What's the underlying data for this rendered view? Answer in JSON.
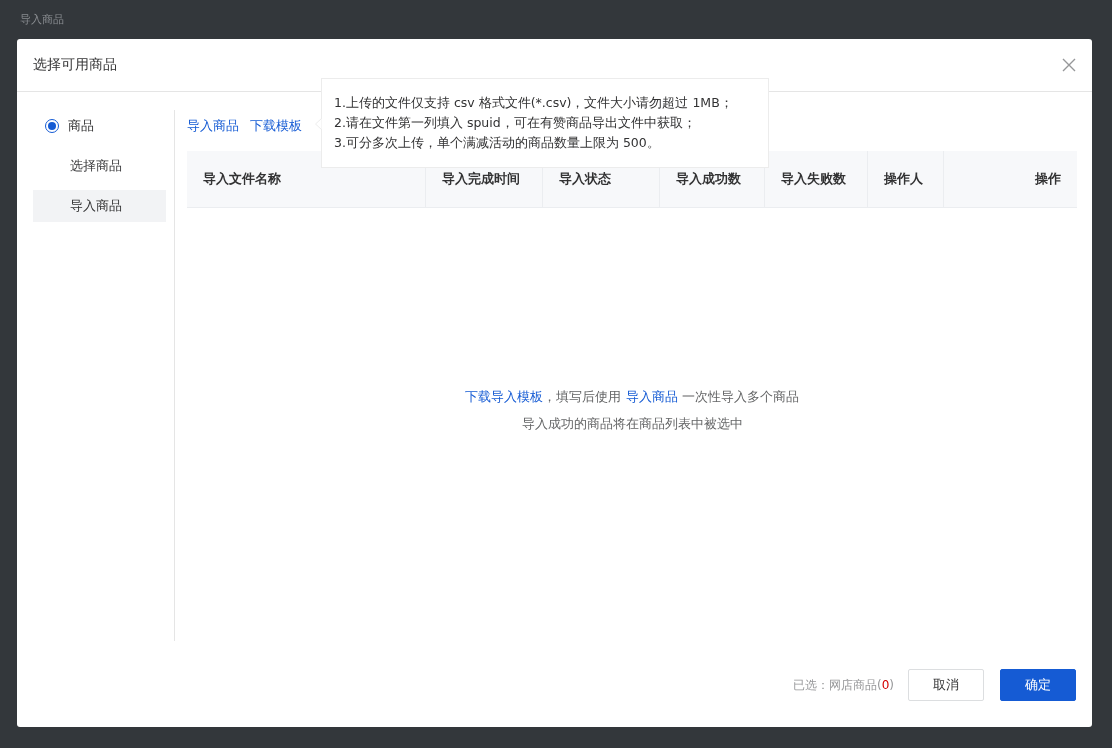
{
  "page_title": "导入商品",
  "dialog": {
    "title": "选择可用商品",
    "sidebar": {
      "group": {
        "label": "商品",
        "selected": true
      },
      "items": [
        {
          "label": "选择商品",
          "selected": false
        },
        {
          "label": "导入商品",
          "selected": true
        }
      ]
    },
    "actions": [
      {
        "label": "导入商品"
      },
      {
        "label": "下载模板"
      }
    ],
    "tooltip": {
      "lines": [
        "1.上传的文件仅支持 csv 格式文件(*.csv)，文件大小请勿超过 1MB；",
        "2.请在文件第一列填入 spuid，可在有赞商品导出文件中获取；",
        "3.可分多次上传，单个满减活动的商品数量上限为 500。"
      ]
    },
    "table": {
      "columns": [
        {
          "label": "导入文件名称"
        },
        {
          "label": "导入完成时间"
        },
        {
          "label": "导入状态"
        },
        {
          "label": "导入成功数"
        },
        {
          "label": "导入失败数"
        },
        {
          "label": "操作人"
        },
        {
          "label": "操作"
        }
      ]
    },
    "empty": {
      "line_1": [
        {
          "kind": "link",
          "text": "下载导入模板"
        },
        {
          "kind": "text",
          "text": "，填写后使用 "
        },
        {
          "kind": "link",
          "text": "导入商品"
        },
        {
          "kind": "text",
          "text": " 一次性导入多个商品"
        }
      ],
      "line_2": "导入成功的商品将在商品列表中被选中"
    },
    "footer": {
      "summary_prefix": "已选：网店商品(",
      "count": "0",
      "summary_suffix": ")",
      "buttons": [
        {
          "label": "取消",
          "kind": "secondary"
        },
        {
          "label": "确定",
          "kind": "primary"
        }
      ]
    }
  }
}
